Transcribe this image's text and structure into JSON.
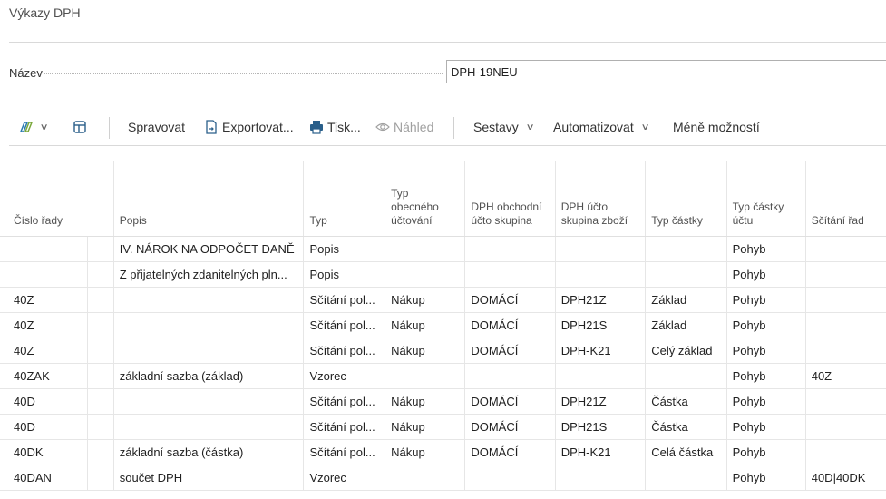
{
  "page": {
    "title": "Výkazy DPH"
  },
  "name_field": {
    "label": "Název",
    "value": "DPH-19NEU"
  },
  "toolbar": {
    "manage": "Spravovat",
    "export": "Exportovat...",
    "print": "Tisk...",
    "preview": "Náhled",
    "reports": "Sestavy",
    "automate": "Automatizovat",
    "fewer": "Méně možností"
  },
  "columns": [
    "Číslo řady",
    "",
    "Popis",
    "Typ",
    "Typ obecného účtování",
    "DPH obchodní účto skupina",
    "DPH účto skupina zboží",
    "Typ částky",
    "Typ částky účtu",
    "Sčítání řad"
  ],
  "rows": [
    [
      "",
      "",
      "IV. NÁROK NA ODPOČET DANĚ",
      "Popis",
      "",
      "",
      "",
      "",
      "Pohyb",
      ""
    ],
    [
      "",
      "",
      "Z přijatelných zdanitelných pln...",
      "Popis",
      "",
      "",
      "",
      "",
      "Pohyb",
      ""
    ],
    [
      "40Z",
      "",
      "",
      "Sčítání pol...",
      "Nákup",
      "DOMÁCÍ",
      "DPH21Z",
      "Základ",
      "Pohyb",
      ""
    ],
    [
      "40Z",
      "",
      "",
      "Sčítání pol...",
      "Nákup",
      "DOMÁCÍ",
      "DPH21S",
      "Základ",
      "Pohyb",
      ""
    ],
    [
      "40Z",
      "",
      "",
      "Sčítání pol...",
      "Nákup",
      "DOMÁCÍ",
      "DPH-K21",
      "Celý základ",
      "Pohyb",
      ""
    ],
    [
      "40ZAK",
      "",
      "základní sazba (základ)",
      "Vzorec",
      "",
      "",
      "",
      "",
      "Pohyb",
      "40Z"
    ],
    [
      "40D",
      "",
      "",
      "Sčítání pol...",
      "Nákup",
      "DOMÁCÍ",
      "DPH21Z",
      "Částka",
      "Pohyb",
      ""
    ],
    [
      "40D",
      "",
      "",
      "Sčítání pol...",
      "Nákup",
      "DOMÁCÍ",
      "DPH21S",
      "Částka",
      "Pohyb",
      ""
    ],
    [
      "40DK",
      "",
      "základní sazba (částka)",
      "Sčítání pol...",
      "Nákup",
      "DOMÁCÍ",
      "DPH-K21",
      "Celá částka",
      "Pohyb",
      ""
    ],
    [
      "40DAN",
      "",
      "součet DPH",
      "Vzorec",
      "",
      "",
      "",
      "",
      "Pohyb",
      "40D|40DK"
    ]
  ]
}
